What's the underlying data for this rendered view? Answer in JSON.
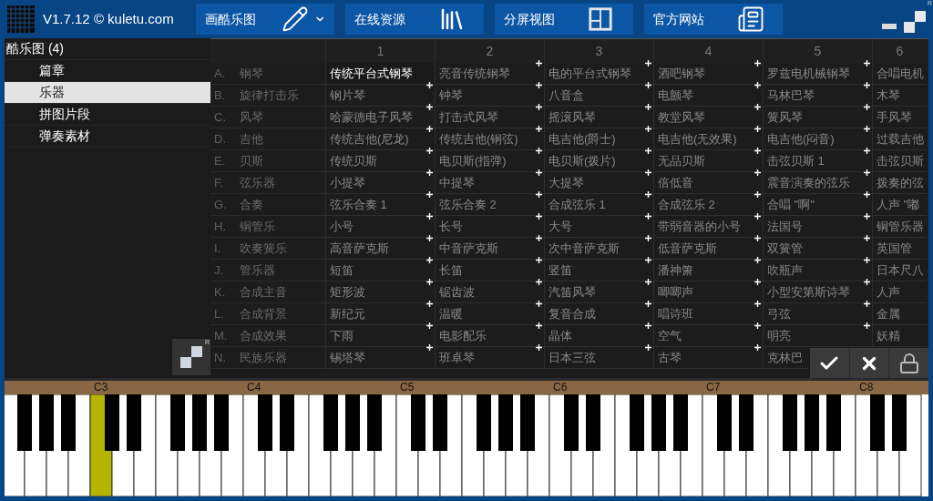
{
  "title_bar": {
    "version": "V1.7.12 © kuletu.com",
    "corner_mark": "R",
    "menu": [
      {
        "label": "画酷乐图",
        "has_caret": true
      },
      {
        "label": "在线资源",
        "has_caret": false
      },
      {
        "label": "分屏视图",
        "has_caret": false
      },
      {
        "label": "官方网站",
        "has_caret": false
      }
    ]
  },
  "sidebar": {
    "title": "酷乐图 (4)",
    "corner_mark": "R",
    "items": [
      {
        "label": "篇章",
        "selected": false
      },
      {
        "label": "乐器",
        "selected": true
      },
      {
        "label": "拼图片段",
        "selected": false
      },
      {
        "label": "弹奏素材",
        "selected": false
      }
    ]
  },
  "grid": {
    "columns": [
      "1",
      "2",
      "3",
      "4",
      "5",
      "6"
    ],
    "rows": [
      {
        "letter": "A.",
        "name": "钢琴",
        "cells": [
          {
            "label": "传统平台式钢琴",
            "selected": true
          },
          {
            "label": "亮音传统钢琴",
            "selected": false
          },
          {
            "label": "电的平台式钢琴",
            "selected": false
          },
          {
            "label": "酒吧钢琴",
            "selected": false
          },
          {
            "label": "罗兹电机械钢琴",
            "selected": false
          },
          {
            "label": "合唱电机",
            "selected": false
          }
        ]
      },
      {
        "letter": "B.",
        "name": "旋律打击乐",
        "cells": [
          {
            "label": "钢片琴",
            "selected": false
          },
          {
            "label": "钟琴",
            "selected": false
          },
          {
            "label": "八音盒",
            "selected": false
          },
          {
            "label": "电颤琴",
            "selected": false
          },
          {
            "label": "马林巴琴",
            "selected": false
          },
          {
            "label": "木琴",
            "selected": false
          }
        ]
      },
      {
        "letter": "C.",
        "name": "风琴",
        "cells": [
          {
            "label": "哈蒙德电子风琴",
            "selected": false
          },
          {
            "label": "打击式风琴",
            "selected": false
          },
          {
            "label": "摇滚风琴",
            "selected": false
          },
          {
            "label": "教堂风琴",
            "selected": false
          },
          {
            "label": "簧风琴",
            "selected": false
          },
          {
            "label": "手风琴",
            "selected": false
          }
        ]
      },
      {
        "letter": "D.",
        "name": "吉他",
        "cells": [
          {
            "label": "传统吉他(尼龙)",
            "selected": false
          },
          {
            "label": "传统吉他(钢弦)",
            "selected": false
          },
          {
            "label": "电吉他(爵士)",
            "selected": false
          },
          {
            "label": "电吉他(无效果)",
            "selected": false
          },
          {
            "label": "电吉他(闷音)",
            "selected": false
          },
          {
            "label": "过载吉他",
            "selected": false
          }
        ]
      },
      {
        "letter": "E.",
        "name": "贝斯",
        "cells": [
          {
            "label": "传统贝斯",
            "selected": false
          },
          {
            "label": "电贝斯(指弹)",
            "selected": false
          },
          {
            "label": "电贝斯(拨片)",
            "selected": false
          },
          {
            "label": "无品贝斯",
            "selected": false
          },
          {
            "label": "击弦贝斯 1",
            "selected": false
          },
          {
            "label": "击弦贝斯",
            "selected": false
          }
        ]
      },
      {
        "letter": "F.",
        "name": "弦乐器",
        "cells": [
          {
            "label": "小提琴",
            "selected": false
          },
          {
            "label": "中提琴",
            "selected": false
          },
          {
            "label": "大提琴",
            "selected": false
          },
          {
            "label": "倍低音",
            "selected": false
          },
          {
            "label": "震音演奏的弦乐",
            "selected": false
          },
          {
            "label": "拨奏的弦",
            "selected": false
          }
        ]
      },
      {
        "letter": "G.",
        "name": "合奏",
        "cells": [
          {
            "label": "弦乐合奏 1",
            "selected": false
          },
          {
            "label": "弦乐合奏 2",
            "selected": false
          },
          {
            "label": "合成弦乐 1",
            "selected": false
          },
          {
            "label": "合成弦乐 2",
            "selected": false
          },
          {
            "label": "合唱 \"啊\"",
            "selected": false
          },
          {
            "label": "人声 \"嘟",
            "selected": false
          }
        ]
      },
      {
        "letter": "H.",
        "name": "铜管乐",
        "cells": [
          {
            "label": "小号",
            "selected": false
          },
          {
            "label": "长号",
            "selected": false
          },
          {
            "label": "大号",
            "selected": false
          },
          {
            "label": "带弱音器的小号",
            "selected": false
          },
          {
            "label": "法国号",
            "selected": false
          },
          {
            "label": "铜管乐器",
            "selected": false
          }
        ]
      },
      {
        "letter": "I.",
        "name": "吹奏簧乐",
        "cells": [
          {
            "label": "高音萨克斯",
            "selected": false
          },
          {
            "label": "中音萨克斯",
            "selected": false
          },
          {
            "label": "次中音萨克斯",
            "selected": false
          },
          {
            "label": "低音萨克斯",
            "selected": false
          },
          {
            "label": "双簧管",
            "selected": false
          },
          {
            "label": "英国管",
            "selected": false
          }
        ]
      },
      {
        "letter": "J.",
        "name": "管乐器",
        "cells": [
          {
            "label": "短笛",
            "selected": false
          },
          {
            "label": "长笛",
            "selected": false
          },
          {
            "label": "竖笛",
            "selected": false
          },
          {
            "label": "潘神箫",
            "selected": false
          },
          {
            "label": "吹瓶声",
            "selected": false
          },
          {
            "label": "日本尺八",
            "selected": false
          }
        ]
      },
      {
        "letter": "K.",
        "name": "合成主音",
        "cells": [
          {
            "label": "矩形波",
            "selected": false
          },
          {
            "label": "锯齿波",
            "selected": false
          },
          {
            "label": "汽笛风琴",
            "selected": false
          },
          {
            "label": "唧唧声",
            "selected": false
          },
          {
            "label": "小型安第斯诗琴",
            "selected": false
          },
          {
            "label": "人声",
            "selected": false
          }
        ]
      },
      {
        "letter": "L.",
        "name": "合成背景",
        "cells": [
          {
            "label": "新纪元",
            "selected": false
          },
          {
            "label": "温暖",
            "selected": false
          },
          {
            "label": "复音合成",
            "selected": false
          },
          {
            "label": "唱诗班",
            "selected": false
          },
          {
            "label": "弓弦",
            "selected": false
          },
          {
            "label": "金属",
            "selected": false
          }
        ]
      },
      {
        "letter": "M.",
        "name": "合成效果",
        "cells": [
          {
            "label": "下雨",
            "selected": false
          },
          {
            "label": "电影配乐",
            "selected": false
          },
          {
            "label": "晶体",
            "selected": false
          },
          {
            "label": "空气",
            "selected": false
          },
          {
            "label": "明亮",
            "selected": false
          },
          {
            "label": "妖精",
            "selected": false
          }
        ]
      },
      {
        "letter": "N.",
        "name": "民族乐器",
        "cells": [
          {
            "label": "锡塔琴",
            "selected": false
          },
          {
            "label": "班卓琴",
            "selected": false
          },
          {
            "label": "日本三弦",
            "selected": false
          },
          {
            "label": "古琴",
            "selected": false
          },
          {
            "label": "克林巴",
            "selected": false
          }
        ]
      }
    ]
  },
  "piano": {
    "white_keys": [
      {
        "pressed": false
      },
      {
        "pressed": false
      },
      {
        "pressed": false
      },
      {
        "pressed": false
      },
      {
        "label": "C3",
        "pressed": true
      },
      {
        "pressed": false
      },
      {
        "pressed": false
      },
      {
        "pressed": false
      },
      {
        "pressed": false
      },
      {
        "pressed": false
      },
      {
        "pressed": false
      },
      {
        "label": "C4",
        "pressed": false
      },
      {
        "pressed": false
      },
      {
        "pressed": false
      },
      {
        "pressed": false
      },
      {
        "pressed": false
      },
      {
        "pressed": false
      },
      {
        "pressed": false
      },
      {
        "label": "C5",
        "pressed": false
      },
      {
        "pressed": false
      },
      {
        "pressed": false
      },
      {
        "pressed": false
      },
      {
        "pressed": false
      },
      {
        "pressed": false
      },
      {
        "pressed": false
      },
      {
        "label": "C6",
        "pressed": false
      },
      {
        "pressed": false
      },
      {
        "pressed": false
      },
      {
        "pressed": false
      },
      {
        "pressed": false
      },
      {
        "pressed": false
      },
      {
        "pressed": false
      },
      {
        "label": "C7",
        "pressed": false
      },
      {
        "pressed": false
      },
      {
        "pressed": false
      },
      {
        "pressed": false
      },
      {
        "pressed": false
      },
      {
        "pressed": false
      },
      {
        "pressed": false
      },
      {
        "label": "C8",
        "pressed": false
      },
      {
        "pressed": false
      },
      {
        "pressed": false
      }
    ]
  }
}
